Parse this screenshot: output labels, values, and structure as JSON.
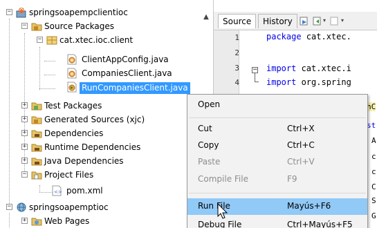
{
  "tree": {
    "items": [
      {
        "label": "springsoapempclientioc",
        "icon": "maven-project-icon",
        "toggle": "−"
      },
      {
        "label": "Source Packages",
        "icon": "source-folder-icon",
        "toggle": "−"
      },
      {
        "label": "cat.xtec.ioc.client",
        "icon": "package-icon",
        "toggle": "−"
      },
      {
        "label": "ClientAppConfig.java",
        "icon": "java-class-icon",
        "toggle": ""
      },
      {
        "label": "CompaniesClient.java",
        "icon": "java-class-icon",
        "toggle": ""
      },
      {
        "label": "RunCompaniesClient.java",
        "icon": "java-class-icon",
        "toggle": ""
      },
      {
        "label": "Test Packages",
        "icon": "test-folder-icon",
        "toggle": "+"
      },
      {
        "label": "Generated Sources (xjc)",
        "icon": "generated-folder-icon",
        "toggle": "+"
      },
      {
        "label": "Dependencies",
        "icon": "library-folder-icon",
        "toggle": "+"
      },
      {
        "label": "Runtime Dependencies",
        "icon": "library-folder-icon",
        "toggle": "+"
      },
      {
        "label": "Java Dependencies",
        "icon": "library-folder-icon",
        "toggle": "+"
      },
      {
        "label": "Project Files",
        "icon": "project-files-folder-icon",
        "toggle": "−"
      },
      {
        "label": "pom.xml",
        "icon": "xml-file-icon",
        "toggle": ""
      },
      {
        "label": "springsoapemptioc",
        "icon": "web-project-icon",
        "toggle": "−"
      },
      {
        "label": "Web Pages",
        "icon": "web-pages-folder-icon",
        "toggle": "+"
      }
    ],
    "selected_index": 5
  },
  "editor": {
    "tabs": [
      {
        "label": "Source",
        "active": true
      },
      {
        "label": "History",
        "active": false
      }
    ],
    "line_numbers": [
      "1",
      "2",
      "3",
      "4"
    ],
    "lines": [
      {
        "keyword": "package",
        "rest": " cat.xtec."
      },
      {
        "keyword": "",
        "rest": ""
      },
      {
        "keyword": "import",
        "rest": " cat.xtec.i"
      },
      {
        "keyword": "import",
        "rest": " org.spring"
      }
    ],
    "peek_fragments": [
      "nC",
      "st",
      "A",
      "c",
      "c",
      "C",
      "S",
      "G"
    ]
  },
  "context_menu": {
    "items": [
      {
        "label": "Open",
        "shortcut": "",
        "enabled": true,
        "highlighted": false
      },
      {
        "label": "Cut",
        "shortcut": "Ctrl+X",
        "enabled": true,
        "highlighted": false
      },
      {
        "label": "Copy",
        "shortcut": "Ctrl+C",
        "enabled": true,
        "highlighted": false
      },
      {
        "label": "Paste",
        "shortcut": "Ctrl+V",
        "enabled": false,
        "highlighted": false
      },
      {
        "label": "Compile File",
        "shortcut": "F9",
        "enabled": false,
        "highlighted": false
      },
      {
        "label": "Run File",
        "shortcut": "Mayús+F6",
        "enabled": true,
        "highlighted": true
      },
      {
        "label": "Debug File",
        "shortcut": "Ctrl+Mayús+F5",
        "enabled": true,
        "highlighted": false
      }
    ]
  },
  "colors": {
    "selection": "#3399ff",
    "menu_highlight": "#91c9f7",
    "keyword": "#0000e6"
  }
}
